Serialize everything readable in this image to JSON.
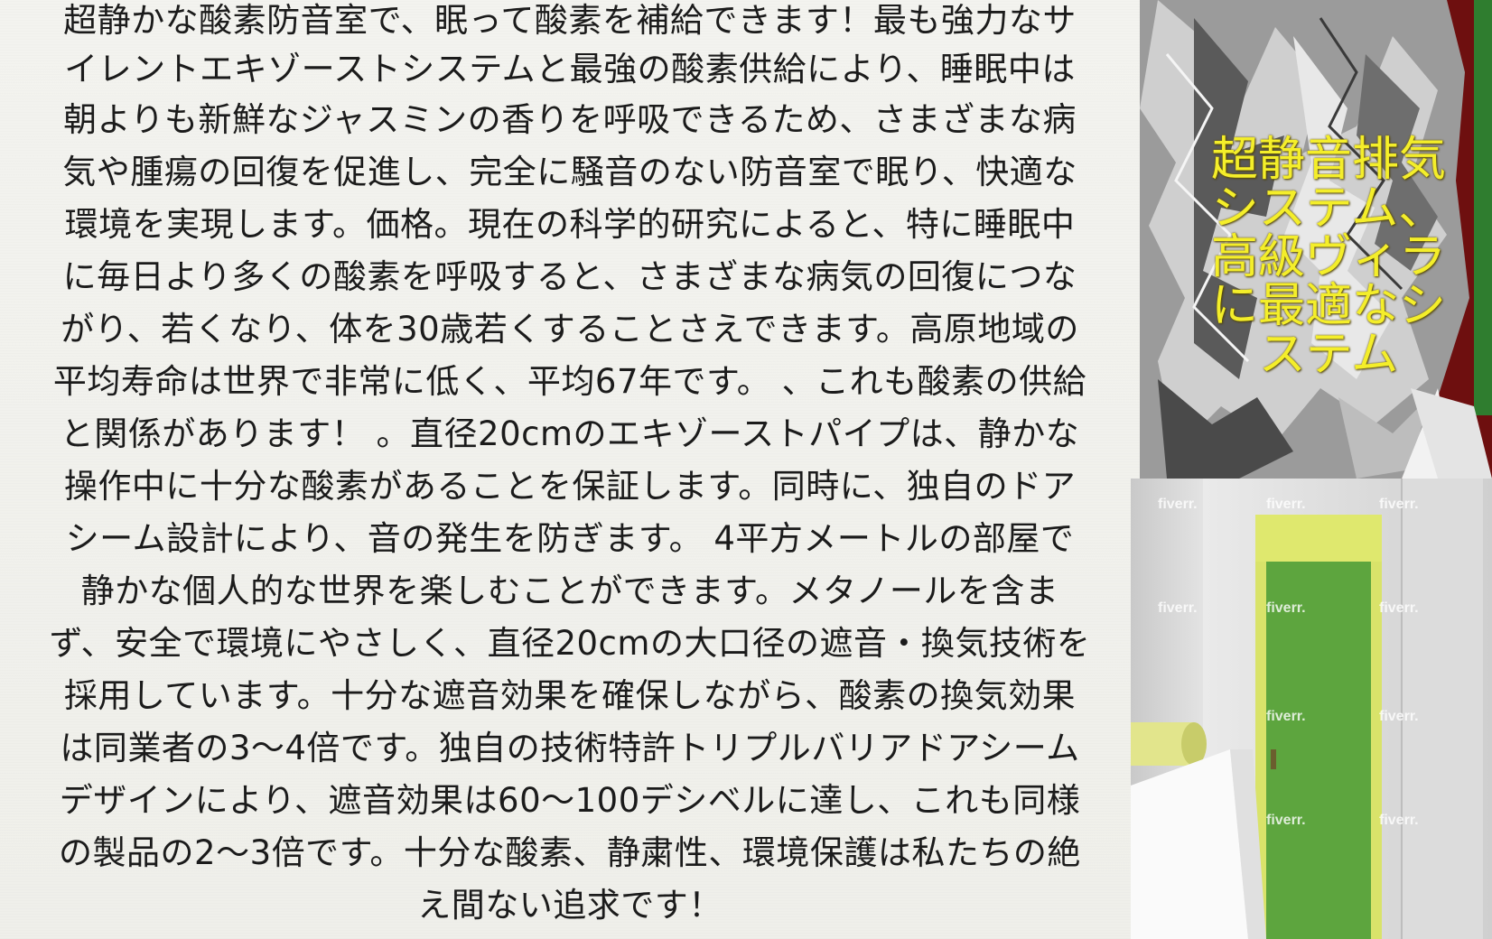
{
  "article": {
    "lines": [
      "超静かな酸素防音室で、眠って酸素を補給できます！最も強力なサ",
      "イレントエキゾーストシステムと最強の酸素供給により、睡眠中は",
      "朝よりも新鮮なジャスミンの香りを呼吸できるため、さまざまな病",
      "気や腫瘍の回復を促進し、完全に騒音のない防音室で眠り、快適な",
      "環境を実現します。価格。現在の科学的研究によると、特に睡眠中",
      "に毎日より多くの酸素を呼吸すると、さまざまな病気の回復につな",
      "がり、若くなり、体を30歳若くすることさえできます。高原地域の",
      "平均寿命は世界で非常に低く、平均67年です。 、これも酸素の供給",
      "と関係があります！ 。直径20cmのエキゾーストパイプは、静かな",
      "操作中に十分な酸素があることを保証します。同時に、独自のドア",
      "シーム設計により、音の発生を防ぎます。 4平方メートルの部屋で",
      "静かな個人的な世界を楽しむことができます。メタノールを含ま",
      "ず、安全で環境にやさしく、直径20cmの大口径の遮音・換気技術を",
      "採用しています。十分な遮音効果を確保しながら、酸素の換気効果",
      "は同業者の3〜4倍です。独自の技術特許トリプルバリアドアシーム",
      "デザインにより、遮音効果は60〜100デシベルに達し、これも同様",
      "の製品の2〜3倍です。十分な酸素、静粛性、環境保護は私たちの絶",
      "え間ない追求です！"
    ]
  },
  "top_image": {
    "overlay_lines": [
      "超静音排気",
      "システム、",
      "高級ヴィラ",
      "に最適なシ",
      "ステム"
    ],
    "overlay_color": "#f4ee2a"
  },
  "bottom_image": {
    "watermark_text": "fiverr.",
    "door_color": "#5da53e",
    "frame_color": "#d9e36a"
  }
}
